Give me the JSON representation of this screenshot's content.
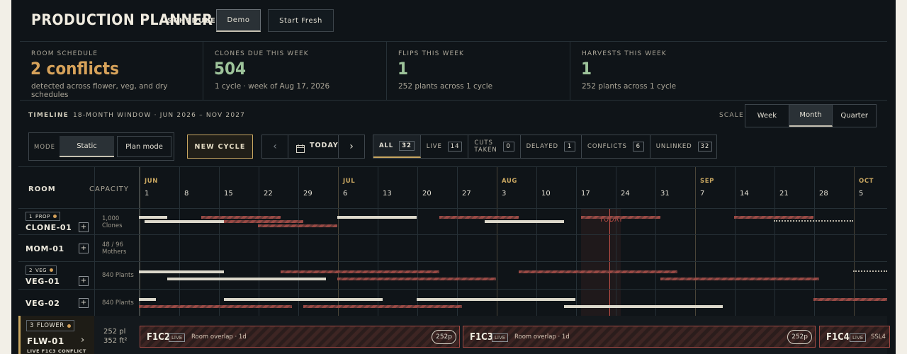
{
  "header": {
    "title": "PRODUCTION PLANNER",
    "schedule_label": "SCHEDULE",
    "demo_label": "Demo",
    "fresh_label": "Start Fresh"
  },
  "stats": [
    {
      "label": "ROOM SCHEDULE",
      "value": "2 conflicts",
      "sub": "detected across flower, veg, and dry schedules",
      "color": "#d6a25a"
    },
    {
      "label": "CLONES DUE THIS WEEK",
      "value": "504",
      "sub": "1 cycle · week of Aug 17, 2026",
      "color": "#9dc39a"
    },
    {
      "label": "FLIPS THIS WEEK",
      "value": "1",
      "sub": "252 plants across 1 cycle",
      "color": "#9dc39a"
    },
    {
      "label": "HARVESTS THIS WEEK",
      "value": "1",
      "sub": "252 plants across 1 cycle",
      "color": "#9dc39a"
    }
  ],
  "timeline": {
    "title": "TIMELINE",
    "window": "18-MONTH WINDOW · JUN 2026 – NOV 2027",
    "scale_label": "SCALE",
    "scale_options": [
      "Week",
      "Month",
      "Quarter"
    ],
    "scale_selected": "Month",
    "mode_label": "MODE",
    "mode_static": "Static",
    "mode_plan": "Plan mode",
    "new_cycle": "NEW CYCLE",
    "today_label": "TODAY",
    "filters": [
      {
        "label": "ALL",
        "count": "32"
      },
      {
        "label": "LIVE",
        "count": "14"
      },
      {
        "label": "CUTS TAKEN",
        "count": "0"
      },
      {
        "label": "DELAYED",
        "count": "1"
      },
      {
        "label": "CONFLICTS",
        "count": "6"
      },
      {
        "label": "UNLINKED",
        "count": "32"
      }
    ]
  },
  "grid": {
    "room_header": "ROOM",
    "capacity_header": "CAPACITY",
    "months": [
      "JUN",
      "JUL",
      "AUG",
      "SEP",
      "OCT"
    ],
    "weeks": [
      "1",
      "8",
      "15",
      "22",
      "29",
      "6",
      "13",
      "20",
      "27",
      "3",
      "10",
      "17",
      "24",
      "31",
      "7",
      "14",
      "21",
      "28",
      "5"
    ],
    "today_marker": "TODAY",
    "rooms": [
      {
        "tag_num": "1",
        "tag": "PROP",
        "name": "CLONE-01",
        "cap1": "1,000",
        "cap2": "Clones"
      },
      {
        "name": "MOM-01",
        "cap1": "48 / 96",
        "cap2": "Mothers"
      },
      {
        "tag_num": "2",
        "tag": "VEG",
        "name": "VEG-01",
        "cap1": "840 Plants"
      },
      {
        "name": "VEG-02",
        "cap1": "840 Plants"
      }
    ],
    "flower": {
      "tag_num": "3",
      "tag": "FLOWER",
      "name": "FLW-01",
      "cap1": "252 pl",
      "cap2": "352 ft²",
      "status": "LIVE F1C3 CONFLICT",
      "blocks": [
        {
          "code": "F1C2",
          "live": "LIVE",
          "msg": "Room overlap · 1d",
          "count": "252p"
        },
        {
          "code": "F1C3",
          "live": "LIVE",
          "msg": "Room overlap · 1d",
          "count": "252p"
        },
        {
          "code": "F1C4",
          "live": "LIVE",
          "msg": "SSL4",
          "count": ""
        }
      ]
    }
  }
}
